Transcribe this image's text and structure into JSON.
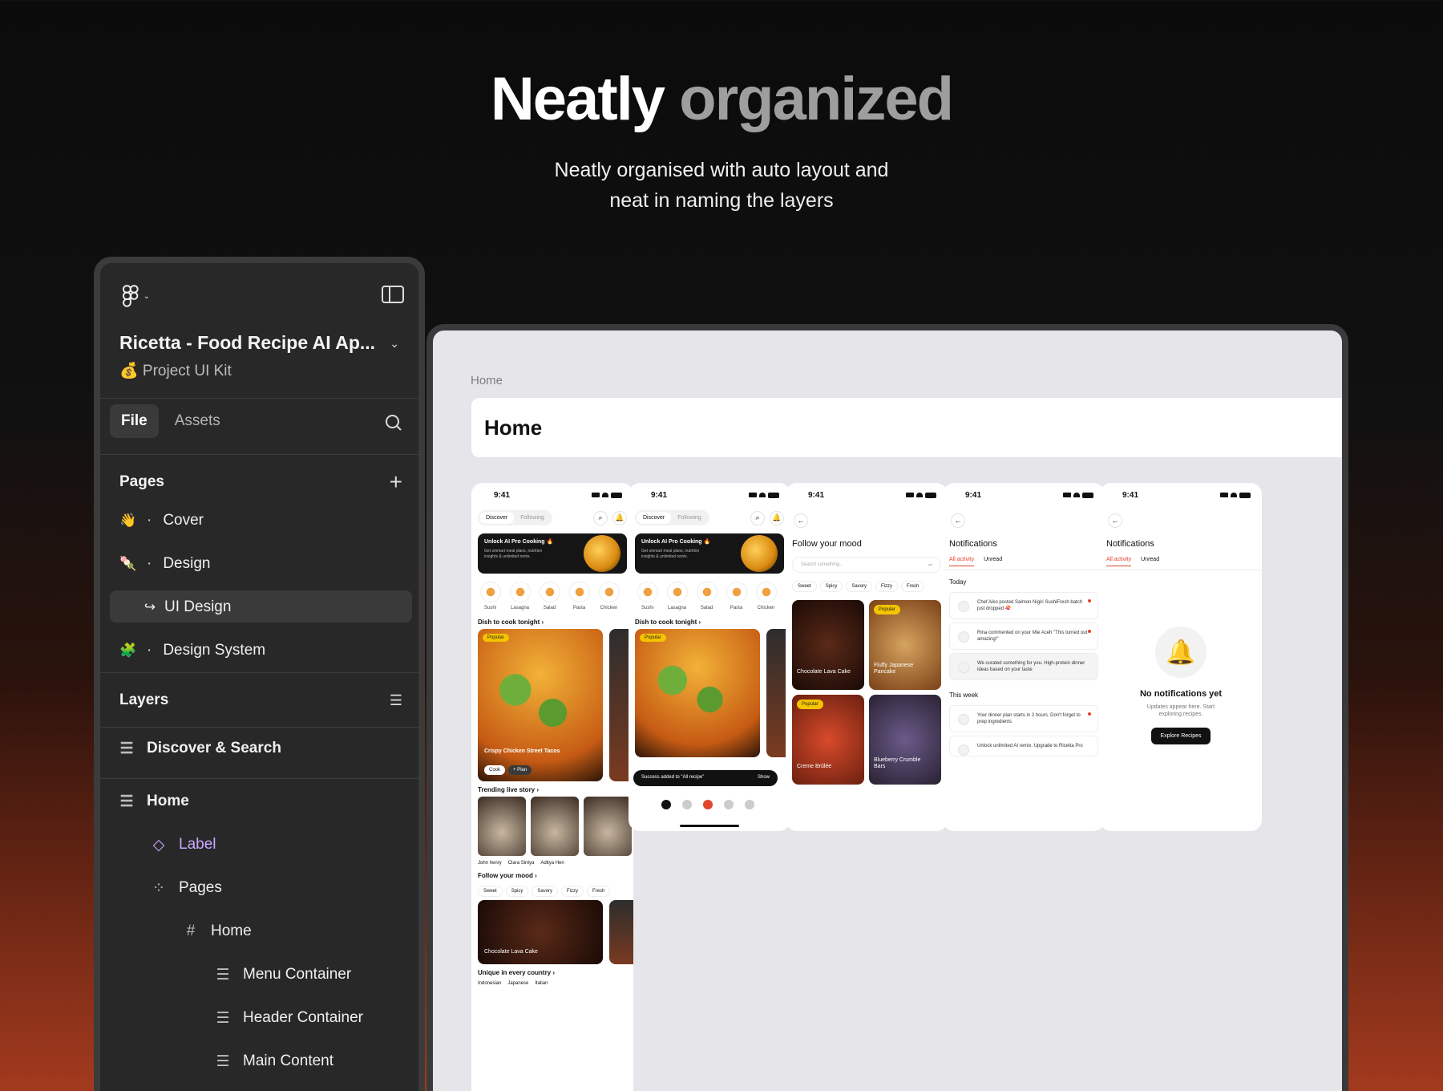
{
  "hero": {
    "title_word1": "Neatly",
    "title_word2": "organized",
    "subtitle_line1": "Neatly organised with auto layout and",
    "subtitle_line2": "neat in naming the layers"
  },
  "panel": {
    "project_title": "Ricetta - Food Recipe AI Ap...",
    "project_subtitle": "💰 Project UI Kit",
    "tab_file": "File",
    "tab_assets": "Assets",
    "pages_header": "Pages",
    "pages": [
      {
        "emoji": "👋",
        "label": "Cover"
      },
      {
        "emoji": "🍡",
        "label": "Design"
      },
      {
        "emoji": "↪",
        "label": "UI Design"
      },
      {
        "emoji": "🧩",
        "label": "Design System"
      }
    ],
    "layers_header": "Layers",
    "layers": [
      {
        "label": "Discover & Search"
      },
      {
        "label": "Home"
      },
      {
        "label": "Label"
      },
      {
        "label": "Pages"
      },
      {
        "label": "Home"
      },
      {
        "label": "Menu Container"
      },
      {
        "label": "Header Container"
      },
      {
        "label": "Main Content"
      }
    ]
  },
  "canvas": {
    "breadcrumb": "Home",
    "frame_title": "Home"
  },
  "screens": {
    "time": "9:41",
    "tab_discover": "Discover",
    "tab_following": "Following",
    "promo_title": "Unlock AI Pro Cooking 🔥",
    "promo_text": "Get smmart meal plans, nutrition insights & unlimited remix.",
    "categories": [
      "Sushi",
      "Lasagna",
      "Salad",
      "Pasta",
      "Chicken"
    ],
    "dish_section": "Dish to cook tonight  ›",
    "popular": "Popular",
    "dish_name": "Crispy Chicken Street Tacos",
    "cook": "Cook",
    "plan": "+ Plan",
    "trending_section": "Trending live story  ›",
    "story_names": [
      "John henry",
      "Clara Sintya",
      "Aditya Hen"
    ],
    "mood_section": "Follow your mood  ›",
    "moods": [
      "Sweet",
      "Spicy",
      "Savory",
      "Fizzy",
      "Fresh"
    ],
    "lava": "Chocolate Lava Cake",
    "country_section": "Unique in every country  ›",
    "countries": [
      "Indonesian",
      "Japanese",
      "Italian"
    ],
    "toast_text": "Success added to \"All recipe\"",
    "toast_action": "Show",
    "mood_title": "Follow your mood",
    "search_placeholder": "Search something..",
    "tiles": [
      "Chocolate Lava Cake",
      "Fluffy Japanese Pancake",
      "Creme Brûlée",
      "Blueberry Crumble Bars"
    ],
    "notif_title": "Notifications",
    "all_activity": "All activity",
    "unread": "Unread",
    "today": "Today",
    "notes_today": [
      "Chef Aiko posted Salmon Nigiri SushiFresh batch just dropped 🍣",
      "Rina commented on your Mie Aceh \"This turned out amazing!\"",
      "We curated something for you. High-protein dinner ideas based on your taste"
    ],
    "this_week": "This week",
    "notes_week": [
      "Your dinner plan starts in 2 hours. Don't forget to prep ingredients",
      "Unlock unlimited AI remix. Upgrade to Ricetta Pro"
    ],
    "empty_title": "No notifications yet",
    "empty_text": "Updates appear here. Start exploring recipes.",
    "explore_btn": "Explore Recipes"
  }
}
